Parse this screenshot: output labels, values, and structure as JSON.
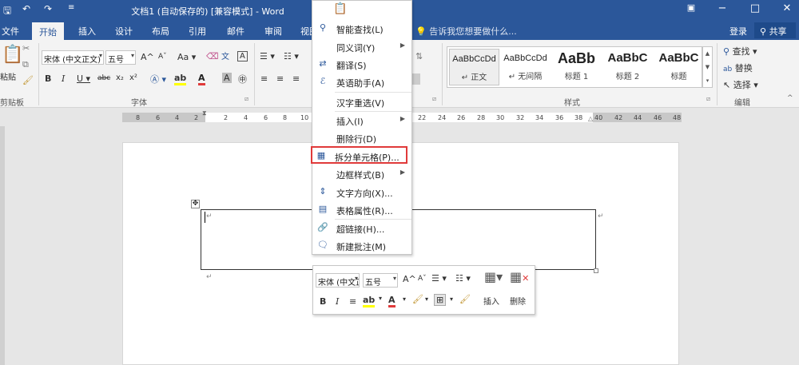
{
  "window": {
    "title": "文档1 (自动保存的) [兼容模式] - Word",
    "qat_icons": [
      "save-icon",
      "undo-icon",
      "redo-icon",
      "customize-icon"
    ],
    "controls": [
      "ribbon-display-icon",
      "minimize-icon",
      "restore-icon",
      "close-icon"
    ]
  },
  "tabs": [
    "文件",
    "开始",
    "插入",
    "设计",
    "布局",
    "引用",
    "邮件",
    "审阅",
    "视图"
  ],
  "active_tab": "开始",
  "tell_me": "告诉我您想要做什么...",
  "login": "登录",
  "share": "共享",
  "ribbon": {
    "clipboard": {
      "paste": "粘贴",
      "label": "剪贴板"
    },
    "font": {
      "name": "宋体 (中文正文)",
      "size": "五号",
      "label": "字体",
      "grow": "A",
      "shrink": "A",
      "case": "Aa"
    },
    "paragraph": {
      "label": "段落"
    },
    "styles": {
      "label": "样式",
      "items": [
        {
          "preview": "AaBbCcDd",
          "name": "↵ 正文"
        },
        {
          "preview": "AaBbCcDd",
          "name": "↵ 无间隔"
        },
        {
          "preview": "AaBb",
          "name": "标题 1"
        },
        {
          "preview": "AaBbC",
          "name": "标题 2"
        },
        {
          "preview": "AaBbC",
          "name": "标题"
        }
      ]
    },
    "editing": {
      "label": "编辑",
      "find": "查找",
      "replace": "替换",
      "select": "选择"
    }
  },
  "ruler": {
    "left_numbers": [
      "8",
      "6",
      "4",
      "2"
    ],
    "numbers": [
      "2",
      "4",
      "6",
      "8",
      "10",
      "22",
      "24",
      "26",
      "28",
      "30",
      "32",
      "34",
      "36",
      "38",
      "40",
      "42",
      "44",
      "46",
      "48"
    ]
  },
  "context_menu": {
    "items": [
      {
        "label": "智能查找(L)",
        "icon": "search-icon"
      },
      {
        "label": "同义词(Y)",
        "icon": "",
        "submenu": true
      },
      {
        "label": "翻译(S)",
        "icon": "translate-icon"
      },
      {
        "label": "英语助手(A)",
        "icon": "english-assistant-icon"
      },
      {
        "label": "汉字重选(V)",
        "icon": ""
      },
      {
        "label": "插入(I)",
        "icon": "",
        "submenu": true
      },
      {
        "label": "删除行(D)",
        "icon": ""
      },
      {
        "label": "拆分单元格(P)...",
        "icon": "split-cells-icon",
        "highlighted": true
      },
      {
        "label": "边框样式(B)",
        "icon": "",
        "submenu": true
      },
      {
        "label": "文字方向(X)...",
        "icon": "text-direction-icon"
      },
      {
        "label": "表格属性(R)...",
        "icon": "table-properties-icon"
      },
      {
        "label": "超链接(H)...",
        "icon": "hyperlink-icon"
      },
      {
        "label": "新建批注(M)",
        "icon": "new-comment-icon"
      }
    ]
  },
  "mini_toolbar": {
    "font": "宋体 (中文正文)",
    "size": "五号",
    "insert": "插入",
    "delete": "删除"
  },
  "colors": {
    "accent": "#2b579a",
    "highlight_border": "#e03a3a",
    "font_color": "#e03a3a",
    "highlighter": "#ffff00"
  }
}
